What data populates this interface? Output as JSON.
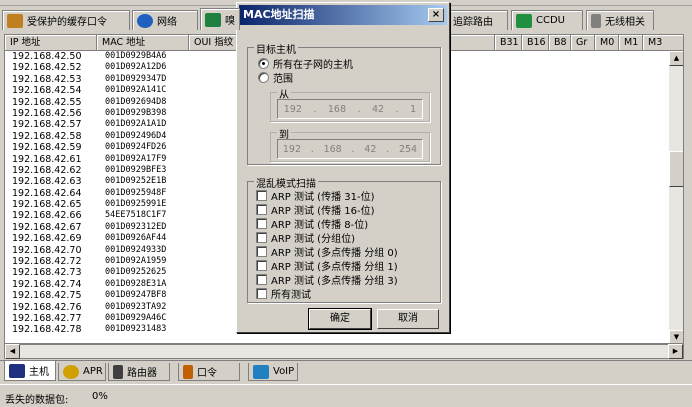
{
  "toolbar_tabs": [
    {
      "label": "受保护的缓存口令",
      "icon": "key-icon",
      "color": "#c08020"
    },
    {
      "label": "网络",
      "icon": "network-icon",
      "color": "#2060c0"
    },
    {
      "label": "嗅",
      "icon": "sniffer-icon",
      "color": "#208040"
    },
    {
      "label": "追踪路由",
      "icon": "",
      "color": ""
    },
    {
      "label": "CCDU",
      "icon": "ccdu-icon",
      "color": "#209040"
    },
    {
      "label": "无线相关",
      "icon": "wireless-icon",
      "color": "#808080"
    }
  ],
  "table": {
    "columns": [
      "IP 地址",
      "MAC 地址",
      "OUI 指纹"
    ],
    "right_columns": [
      "B31",
      "B16",
      "B8",
      "Gr",
      "M0",
      "M1",
      "M3"
    ],
    "rows": [
      {
        "ip": "192.168.42.50",
        "mac": "001D0929B4A6"
      },
      {
        "ip": "192.168.42.52",
        "mac": "001D092A12D6"
      },
      {
        "ip": "192.168.42.53",
        "mac": "001D0929347D"
      },
      {
        "ip": "192.168.42.54",
        "mac": "001D092A141C"
      },
      {
        "ip": "192.168.42.55",
        "mac": "001D092694D8"
      },
      {
        "ip": "192.168.42.56",
        "mac": "001D0929B398"
      },
      {
        "ip": "192.168.42.57",
        "mac": "001D092A1A1D"
      },
      {
        "ip": "192.168.42.58",
        "mac": "001D092496D4"
      },
      {
        "ip": "192.168.42.59",
        "mac": "001D0924FD26"
      },
      {
        "ip": "192.168.42.61",
        "mac": "001D092A17F9"
      },
      {
        "ip": "192.168.42.62",
        "mac": "001D0929BFE3"
      },
      {
        "ip": "192.168.42.63",
        "mac": "001D09252E1B"
      },
      {
        "ip": "192.168.42.64",
        "mac": "001D0925948F"
      },
      {
        "ip": "192.168.42.65",
        "mac": "001D0925991E"
      },
      {
        "ip": "192.168.42.66",
        "mac": "54EE7518C1F7"
      },
      {
        "ip": "192.168.42.67",
        "mac": "001D092312ED"
      },
      {
        "ip": "192.168.42.69",
        "mac": "001D0926AF44"
      },
      {
        "ip": "192.168.42.70",
        "mac": "001D0924933D"
      },
      {
        "ip": "192.168.42.72",
        "mac": "001D092A1959"
      },
      {
        "ip": "192.168.42.73",
        "mac": "001D09252625"
      },
      {
        "ip": "192.168.42.74",
        "mac": "001D0928E31A"
      },
      {
        "ip": "192.168.42.75",
        "mac": "001D09247BF8"
      },
      {
        "ip": "192.168.42.76",
        "mac": "001D0923TA92"
      },
      {
        "ip": "192.168.42.77",
        "mac": "001D0929A46C"
      },
      {
        "ip": "192.168.42.78",
        "mac": "001D09231483"
      }
    ]
  },
  "bottom_tabs": [
    {
      "label": "主机",
      "icon": "host-icon",
      "color": "#203080"
    },
    {
      "label": "APR",
      "icon": "apr-icon",
      "color": "#d0a000"
    },
    {
      "label": "路由器",
      "icon": "router-icon",
      "color": "#404040"
    },
    {
      "label": "口令",
      "icon": "password-icon",
      "color": "#c06000"
    },
    {
      "label": "VoIP",
      "icon": "voip-icon",
      "color": "#2080c0"
    }
  ],
  "status": {
    "label": "丢失的数据包:",
    "value": "0%"
  },
  "dialog": {
    "title": "MAC地址扫描",
    "close": "×",
    "target_group": "目标主机",
    "radio_all": "所有在子网的主机",
    "radio_range": "范围",
    "from_label": "从",
    "from_ip": [
      "192",
      "168",
      "42",
      "1"
    ],
    "to_label": "到",
    "to_ip": [
      "192",
      "168",
      "42",
      "254"
    ],
    "promisc_group": "混乱模式扫描",
    "checks": [
      "ARP 测试 (传播 31-位)",
      "ARP 测试 (传播 16-位)",
      "ARP 测试 (传播 8-位)",
      "ARP 测试 (分组位)",
      "ARP 测试 (多点传播 分组 0)",
      "ARP 测试 (多点传播 分组 1)",
      "ARP 测试 (多点传播 分组 3)",
      "所有测试"
    ],
    "ok": "确定",
    "cancel": "取消"
  }
}
